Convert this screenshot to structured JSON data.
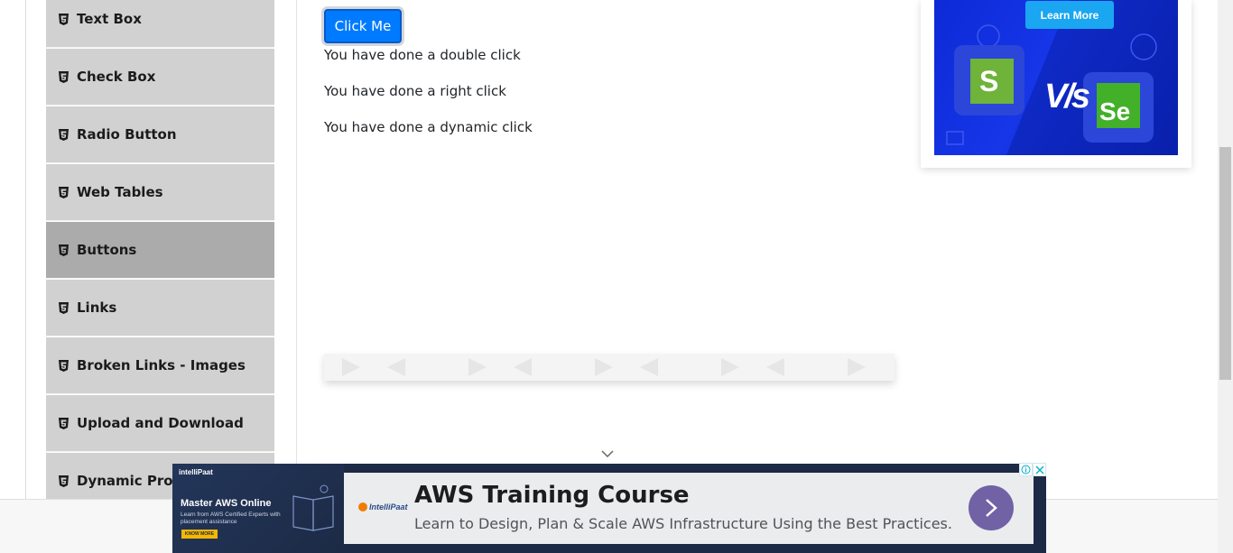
{
  "sidebar": {
    "items": [
      {
        "label": "Text Box"
      },
      {
        "label": "Check Box"
      },
      {
        "label": "Radio Button"
      },
      {
        "label": "Web Tables"
      },
      {
        "label": "Buttons"
      },
      {
        "label": "Links"
      },
      {
        "label": "Broken Links - Images"
      },
      {
        "label": "Upload and Download"
      },
      {
        "label": "Dynamic Prop"
      }
    ]
  },
  "main": {
    "click_button_label": "Click Me",
    "messages": [
      "You have done a double click",
      "You have done a right click",
      "You have done a dynamic click"
    ]
  },
  "right_ad": {
    "learn_more_label": "Learn More",
    "left_logo_letter": "S",
    "vs_text": "V/s",
    "right_logo_text": "Se"
  },
  "bottom_ad": {
    "brand": "intelliPaat",
    "left_heading": "Master AWS Online",
    "left_subtext": "Learn from AWS Certified Experts with placement assistance",
    "left_cta": "KNOW MORE",
    "logo_text": "IntelliPaat",
    "title": "AWS Training Course",
    "subtitle": "Learn to Design, Plan & Scale AWS Infrastructure Using the Best Practices."
  },
  "colors": {
    "primary_button": "#007bff",
    "sidebar_bg": "#d1d1d1",
    "sidebar_active": "#ababab",
    "ad_go_button": "#7162a6"
  }
}
